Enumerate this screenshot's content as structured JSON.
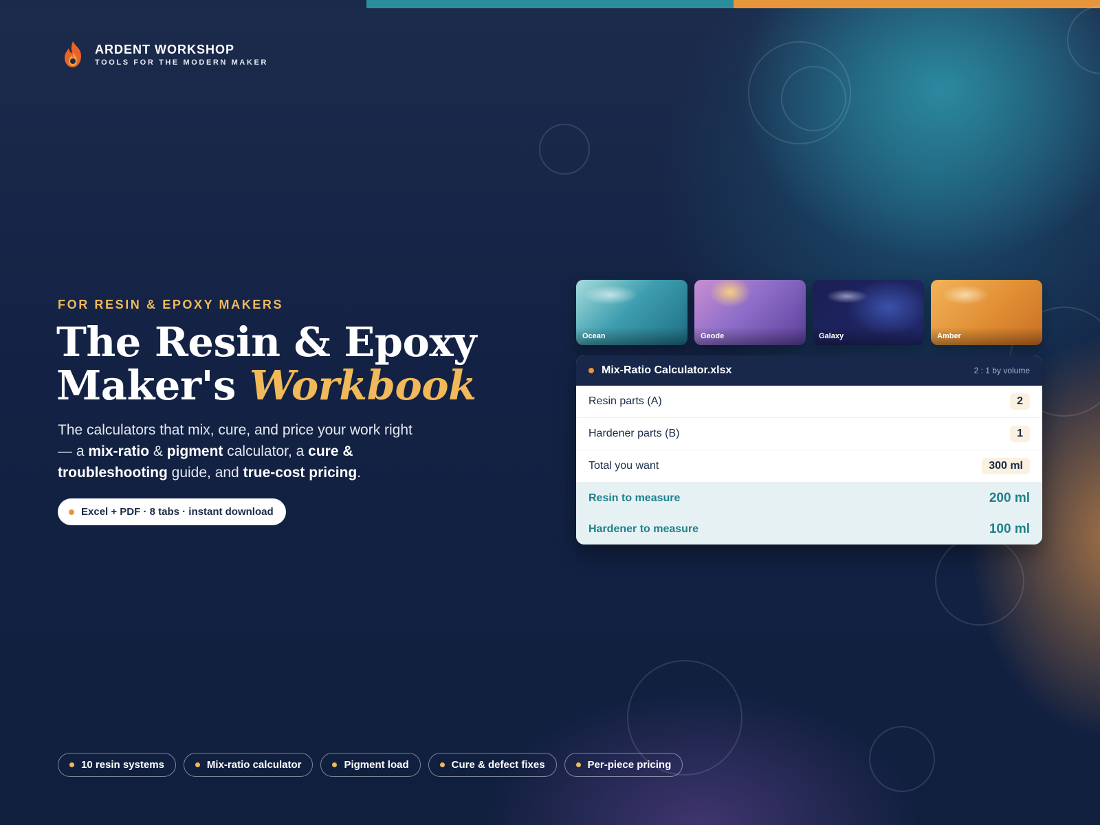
{
  "brand": {
    "name": "ARDENT WORKSHOP",
    "tagline": "TOOLS FOR THE MODERN MAKER",
    "logo_icon": "flame-icon"
  },
  "hero": {
    "eyebrow": "FOR RESIN & EPOXY MAKERS",
    "title_line1": "The Resin & Epoxy",
    "title_line2": "Maker's",
    "title_accent": "Workbook",
    "lede": {
      "p1": "The calculators that mix, cure, and price your work right — a ",
      "b1": "mix-ratio",
      "p2": " & ",
      "b2": "pigment",
      "p3": " calculator, a ",
      "b3": "cure & troubleshooting",
      "p4": " guide, and ",
      "b4": "true-cost pricing",
      "p5": "."
    },
    "pill": "Excel + PDF · 8 tabs · instant download"
  },
  "swatches": [
    {
      "label": "Ocean"
    },
    {
      "label": "Geode"
    },
    {
      "label": "Galaxy"
    },
    {
      "label": "Amber"
    }
  ],
  "calculator": {
    "file_name": "Mix-Ratio Calculator.xlsx",
    "note": "2 : 1 by volume",
    "inputs": [
      {
        "label": "Resin parts (A)",
        "value": "2"
      },
      {
        "label": "Hardener parts (B)",
        "value": "1"
      },
      {
        "label": "Total you want",
        "value": "300 ml"
      }
    ],
    "outputs": [
      {
        "label": "Resin to measure",
        "value": "200 ml"
      },
      {
        "label": "Hardener to measure",
        "value": "100 ml"
      }
    ]
  },
  "tags": [
    "10 resin systems",
    "Mix-ratio calculator",
    "Pigment load",
    "Cure & defect fixes",
    "Per-piece pricing"
  ],
  "colors": {
    "accent_gold": "#f1b95a",
    "accent_orange": "#e8963c",
    "teal": "#2b8e9c",
    "navy": "#17284a"
  }
}
